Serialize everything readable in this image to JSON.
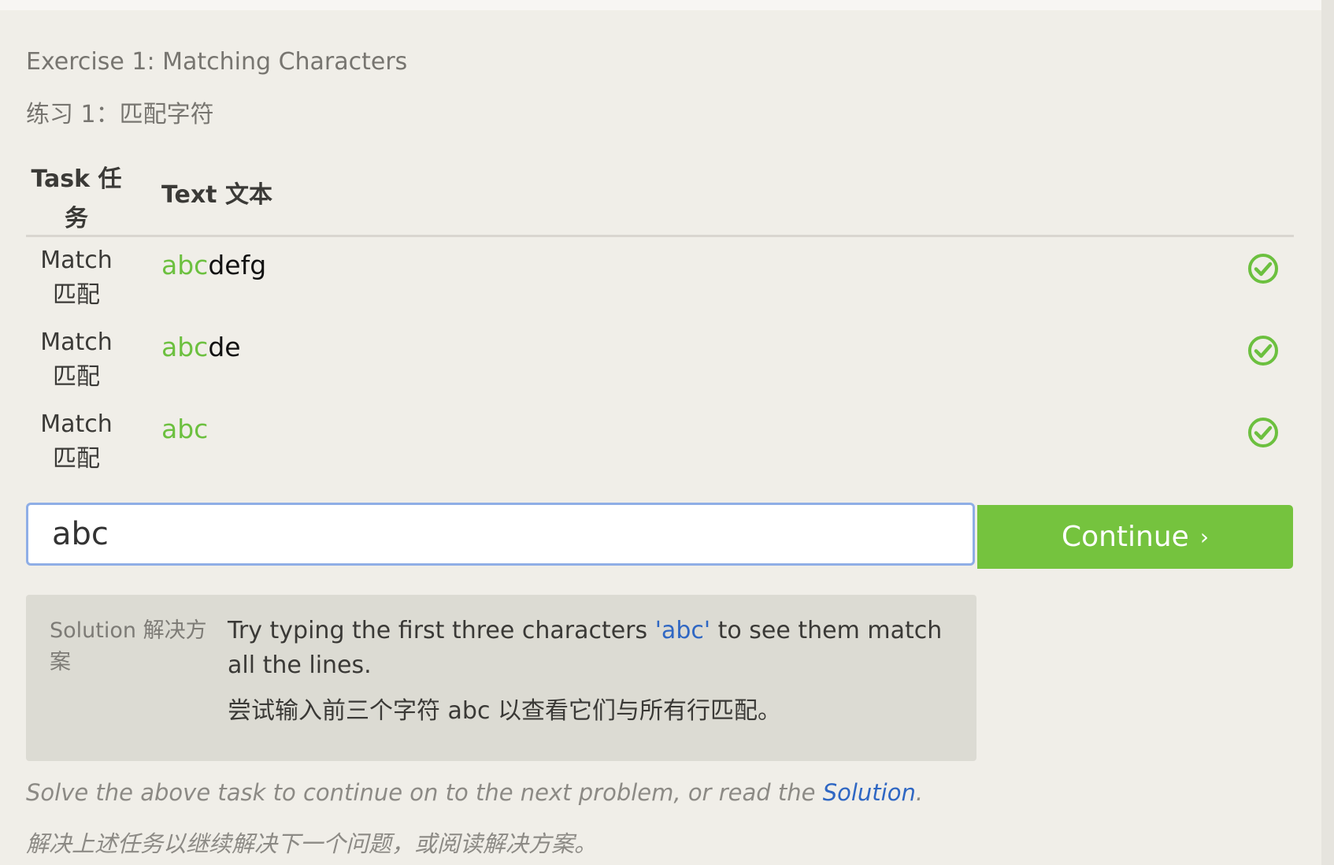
{
  "exercise": {
    "title_en": "Exercise 1: Matching Characters",
    "title_zh": "练习 1：匹配字符"
  },
  "table": {
    "headers": {
      "task": "Task 任务",
      "text": "Text 文本"
    },
    "rows": [
      {
        "task": "Match 匹配",
        "match": "abc",
        "rest": "defg",
        "status_icon": "check-circle-icon"
      },
      {
        "task": "Match 匹配",
        "match": "abc",
        "rest": "de",
        "status_icon": "check-circle-icon"
      },
      {
        "task": "Match 匹配",
        "match": "abc",
        "rest": "",
        "status_icon": "check-circle-icon"
      }
    ]
  },
  "input": {
    "value": "abc"
  },
  "continue_button": {
    "label": "Continue",
    "arrow": "›"
  },
  "solution": {
    "label": "Solution 解决方案",
    "en_before": "Try typing the first three characters ",
    "en_quote": "'abc'",
    "en_after": " to see them match all the lines.",
    "zh": "尝试输入前三个字符 abc 以查看它们与所有行匹配。"
  },
  "footer": {
    "en_before": "Solve the above task to continue on to the next problem, or read the ",
    "en_link": "Solution",
    "en_after": ".",
    "zh": "解决上述任务以继续解决下一个问题，或阅读解决方案。"
  },
  "colors": {
    "match_green": "#6cc03f",
    "button_green": "#75c33e",
    "link_blue": "#2f67c3",
    "input_focus_border": "#8faee6",
    "background": "#f0eee8"
  }
}
